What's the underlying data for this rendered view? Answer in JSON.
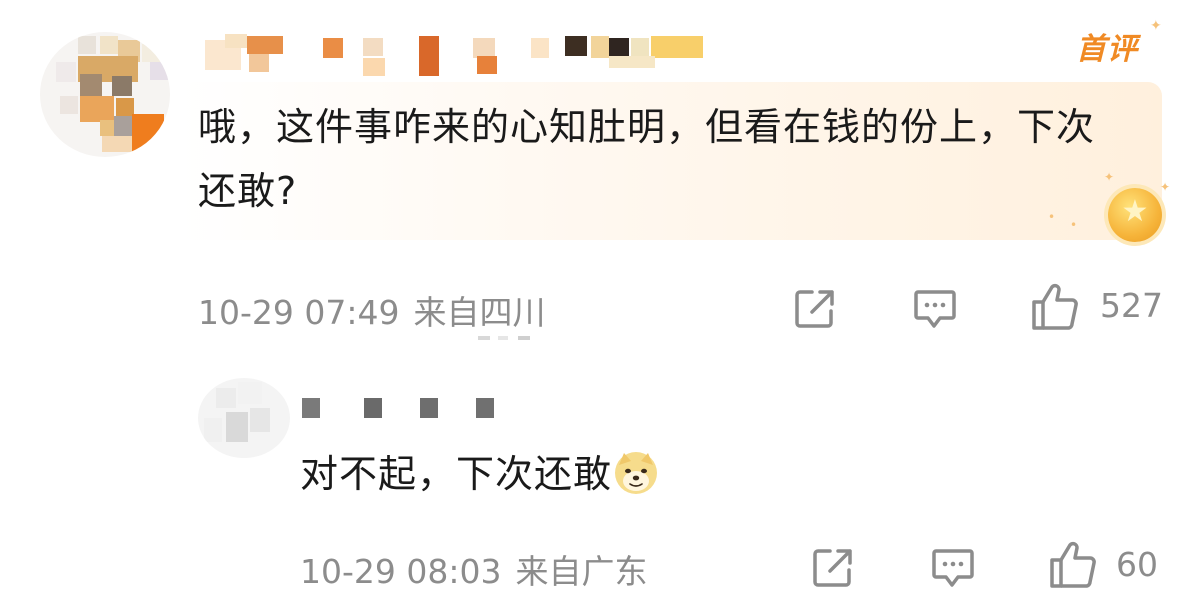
{
  "comment": {
    "author_blurred": true,
    "badge_label": "首评",
    "text": "哦，这件事咋来的心知肚明，但看在钱的份上，下次还敢?",
    "timestamp": "10-29 07:49",
    "location": "来自四川",
    "like_count": "527",
    "accent_color": "#f08a24"
  },
  "reply": {
    "author_blurred": true,
    "text": "对不起，下次还敢",
    "emoji": "doge-emoji",
    "timestamp": "10-29 08:03",
    "location": "来自广东",
    "like_count": "60"
  },
  "icons": {
    "share": "share-icon",
    "comment": "comment-icon",
    "like": "like-icon"
  }
}
